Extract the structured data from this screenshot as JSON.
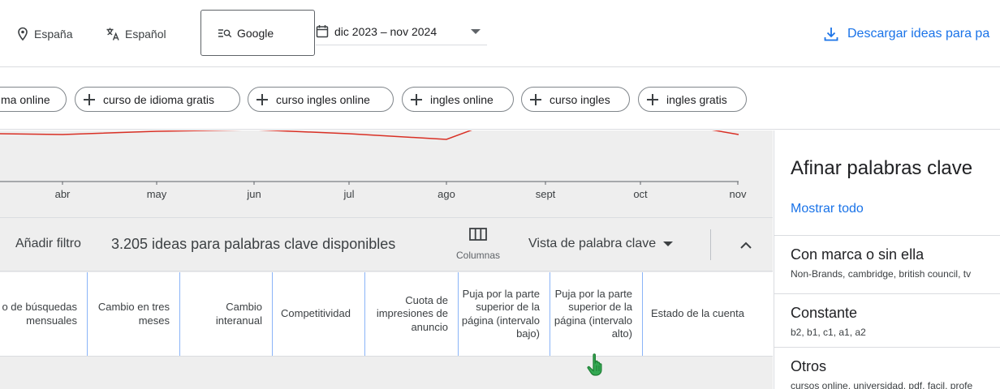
{
  "topbar": {
    "location": "España",
    "language": "Español",
    "network": "Google",
    "date_range": "dic 2023 – nov 2024",
    "download_label": "Descargar ideas para pa"
  },
  "chips": [
    {
      "label": "ma online"
    },
    {
      "label": "curso de idioma gratis"
    },
    {
      "label": "curso ingles online"
    },
    {
      "label": "ingles online"
    },
    {
      "label": "curso ingles"
    },
    {
      "label": "ingles gratis"
    }
  ],
  "chart": {
    "months": [
      "abr",
      "may",
      "jun",
      "jul",
      "ago",
      "sept",
      "oct",
      "nov"
    ],
    "line_color": "#d93025"
  },
  "filterbar": {
    "add_filter": "Añadir filtro",
    "ideas_count": "3.205 ideas para palabras clave disponibles",
    "columns_label": "Columnas",
    "view_label": "Vista de palabra clave"
  },
  "table": {
    "headers": [
      "o de búsquedas mensuales",
      "Cambio en tres meses",
      "Cambio interanual",
      "Competitividad",
      "Cuota de impresiones de anuncio",
      "Puja por la parte superior de la página (intervalo bajo)",
      "Puja por la parte superior de la página (intervalo alto)",
      "Estado de la cuenta"
    ]
  },
  "refine": {
    "title": "Afinar palabras clave",
    "show_all": "Mostrar todo",
    "sections": [
      {
        "title": "Con marca o sin ella",
        "subtitle": "Non-Brands, cambridge, british council, tv"
      },
      {
        "title": "Constante",
        "subtitle": "b2, b1, c1, a1, a2"
      },
      {
        "title": "Otros",
        "subtitle": "cursos online, universidad, pdf, facil, profe"
      }
    ]
  },
  "colors": {
    "accent": "#1a73e8",
    "column_divider": "#8ab4f8",
    "cursor": "#34a853"
  },
  "icons": {
    "location": "location-pin-icon",
    "language": "translate-icon",
    "network": "search-list-icon",
    "date": "calendar-icon",
    "download": "download-icon",
    "columns": "columns-icon",
    "collapse": "chevron-up-icon",
    "cursor": "hand-pointer-icon"
  }
}
